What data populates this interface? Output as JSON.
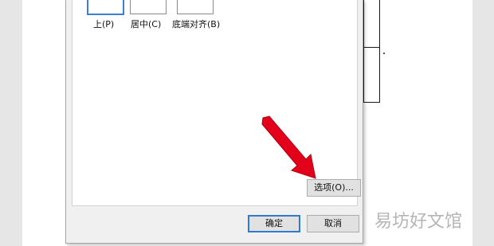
{
  "dialog": {
    "vertical_alignment": {
      "options": [
        {
          "label": "上(P)",
          "selected": true
        },
        {
          "label": "居中(C)",
          "selected": false
        },
        {
          "label": "底端对齐(B)",
          "selected": false
        }
      ]
    },
    "options_button": "选项(O)...",
    "ok_button": "确定",
    "cancel_button": "取消"
  },
  "watermark": "易坊好文馆",
  "colors": {
    "arrow": "#e3001b",
    "default_button_border": "#2f7bd1",
    "selected_option_border": "#3c7fd6"
  }
}
